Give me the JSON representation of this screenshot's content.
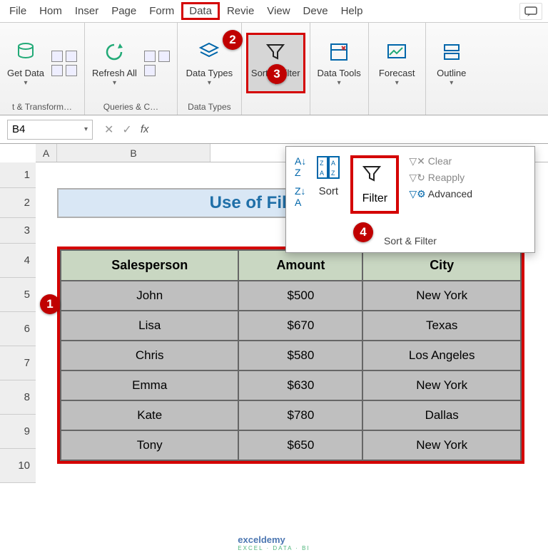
{
  "tabs": {
    "file": "File",
    "home": "Hom",
    "insert": "Inser",
    "page": "Page",
    "form": "Form",
    "data": "Data",
    "review": "Revie",
    "view": "View",
    "dev": "Deve",
    "help": "Help"
  },
  "ribbon": {
    "get_data": "Get Data",
    "get_transform": "t & Transform…",
    "refresh": "Refresh All",
    "queries": "Queries & C…",
    "datatypes": "Data Types",
    "datatypes_group": "Data Types",
    "sortfilter": "Sort & Filter",
    "datatools": "Data Tools",
    "forecast": "Forecast",
    "outline": "Outline"
  },
  "dropdown": {
    "sortAZ": "A→Z",
    "sortZA": "Z→A",
    "sort": "Sort",
    "filter": "Filter",
    "clear": "Clear",
    "reapply": "Reapply",
    "advanced": "Advanced",
    "footer": "Sort & Filter"
  },
  "namebox": "B4",
  "fx": "fx",
  "cols": {
    "A": "A",
    "B": "B"
  },
  "rows": [
    "1",
    "2",
    "3",
    "4",
    "5",
    "6",
    "7",
    "8",
    "9",
    "10"
  ],
  "title": "Use of Filter Option",
  "table": {
    "headers": {
      "sp": "Salesperson",
      "amt": "Amount",
      "city": "City"
    },
    "data": [
      {
        "sp": "John",
        "amt": "$500",
        "city": "New York"
      },
      {
        "sp": "Lisa",
        "amt": "$670",
        "city": "Texas"
      },
      {
        "sp": "Chris",
        "amt": "$580",
        "city": "Los Angeles"
      },
      {
        "sp": "Emma",
        "amt": "$630",
        "city": "New York"
      },
      {
        "sp": "Kate",
        "amt": "$780",
        "city": "Dallas"
      },
      {
        "sp": "Tony",
        "amt": "$650",
        "city": "New York"
      }
    ]
  },
  "callouts": {
    "c1": "1",
    "c2": "2",
    "c3": "3",
    "c4": "4"
  },
  "watermark": "exceldemy",
  "watermark_sub": "EXCEL · DATA · BI"
}
